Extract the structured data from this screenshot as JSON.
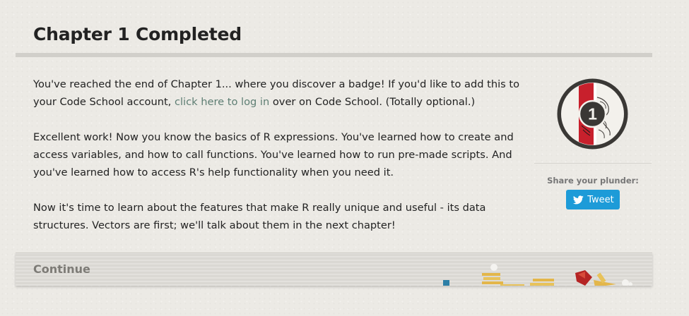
{
  "heading": {
    "title": "Chapter 1 Completed"
  },
  "content": {
    "p1_before_link": "You've reached the end of Chapter 1... where you discover a badge! If you'd like to add this to your Code School account, ",
    "p1_link": "click here to log in",
    "p1_after_link": " over on Code School. (Totally optional.)",
    "p2": "Excellent work! Now you know the basics of R expressions. You've learned how to create and access variables, and how to call functions. You've learned how to run pre-made scripts. And you've learned how to access R's help functionality when you need it.",
    "p3": "Now it's time to learn about the features that make R really unique and useful - its data structures. Vectors are first; we'll talk about them in the next chapter!"
  },
  "badge": {
    "number": "1",
    "icon": "chapter-badge-icon",
    "colors": {
      "ring": "#3a3835",
      "band": "#c8202c",
      "center": "#3a3835"
    }
  },
  "share": {
    "label": "Share your plunder:",
    "tweet_label": "Tweet",
    "tweet_icon": "twitter-bird-icon",
    "tweet_color": "#1d9bd8"
  },
  "footer": {
    "continue_label": "Continue"
  },
  "colors": {
    "background": "#eceae5",
    "link": "#5e7e73",
    "rule": "#d1cfca"
  }
}
